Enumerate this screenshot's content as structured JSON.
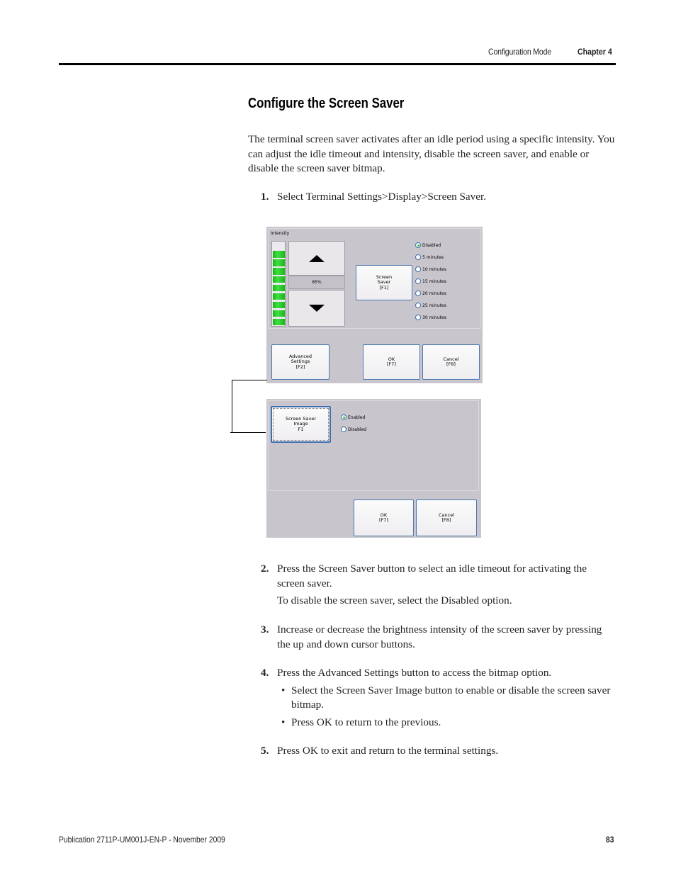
{
  "header": {
    "section": "Configuration Mode",
    "chapter": "Chapter 4"
  },
  "title": "Configure the Screen Saver",
  "intro": "The terminal screen saver activates after an idle period using a specific intensity. You can adjust the idle timeout and intensity, disable the screen saver, and enable or disable the screen saver bitmap.",
  "steps": [
    {
      "num": "1.",
      "text": "Select Terminal Settings>Display>Screen Saver."
    },
    {
      "num": "2.",
      "text": "Press the Screen Saver button to select an idle timeout for activating the screen saver.",
      "note": "To disable the screen saver, select the Disabled option."
    },
    {
      "num": "3.",
      "text": "Increase or decrease the brightness intensity of the screen saver by pressing the up and down cursor buttons."
    },
    {
      "num": "4.",
      "text": "Press the Advanced Settings button to access the bitmap option.",
      "bullets": [
        "Select the Screen Saver Image button to enable or disable the screen saver bitmap.",
        "Press OK to return to the previous."
      ]
    },
    {
      "num": "5.",
      "text": "Press OK to exit and return to the terminal settings."
    }
  ],
  "screen1": {
    "intensity_label": "Intensity",
    "intensity_value": "85%",
    "intensity_segments_filled": 9,
    "intensity_segments_total": 10,
    "screen_saver_button": "Screen\nSaver\n[F1]",
    "timeout_options": [
      {
        "label": "Disabled",
        "selected": true
      },
      {
        "label": "5 minutes",
        "selected": false
      },
      {
        "label": "10 minutes",
        "selected": false
      },
      {
        "label": "15 minutes",
        "selected": false
      },
      {
        "label": "20 minutes",
        "selected": false
      },
      {
        "label": "25 minutes",
        "selected": false
      },
      {
        "label": "30 minutes",
        "selected": false
      }
    ],
    "advanced_button": "Advanced\nSettings\n[F2]",
    "ok_button": "OK\n[F7]",
    "cancel_button": "Cancel\n[F8]"
  },
  "screen2": {
    "image_button": "Screen Saver\nImage\nF1",
    "options": [
      {
        "label": "Enabled",
        "selected": true
      },
      {
        "label": "Disabled",
        "selected": false
      }
    ],
    "ok_button": "OK\n[F7]",
    "cancel_button": "Cancel\n[F8]"
  },
  "colors": {
    "panel_bg": "#c8c5cc",
    "intensity_green": "#2fc02f",
    "button_border": "#4a7ab0"
  },
  "footer": {
    "publication": "Publication 2711P-UM001J-EN-P - November 2009",
    "page": "83"
  }
}
